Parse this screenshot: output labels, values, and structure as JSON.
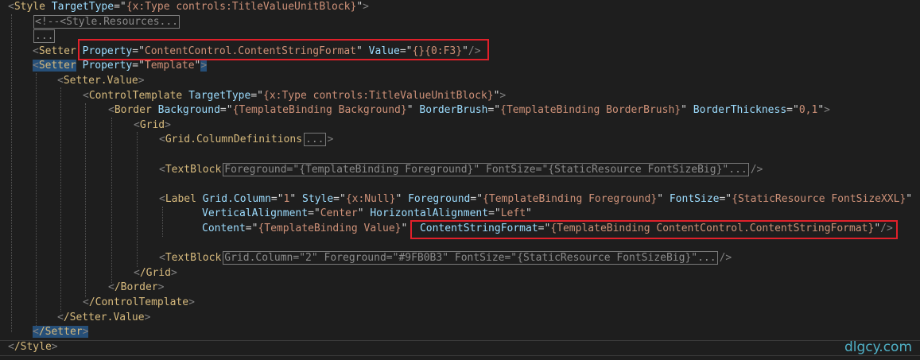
{
  "lines": {
    "l1": {
      "tag": "Style",
      "attr": "TargetType",
      "value": "{x:Type controls:TitleValueUnitBlock}"
    },
    "l2": {
      "collapsed": "<!--<Style.Resources..."
    },
    "l3": {
      "collapsed": "..."
    },
    "l4": {
      "tag": "Setter",
      "attr1": "Property",
      "value1": "ContentControl.ContentStringFormat",
      "attr2": "Value",
      "value2": "{}{0:F3}"
    },
    "l5": {
      "tag": "Setter",
      "attr": "Property",
      "value": "Template"
    },
    "l6": {
      "tag": "Setter.Value"
    },
    "l7": {
      "tag": "ControlTemplate",
      "attr": "TargetType",
      "value": "{x:Type controls:TitleValueUnitBlock}"
    },
    "l8": {
      "tag": "Border",
      "attr1": "Background",
      "value1": "{TemplateBinding Background}",
      "attr2": "BorderBrush",
      "value2": "{TemplateBinding BorderBrush}",
      "attr3": "BorderThickness",
      "value3": "0,1"
    },
    "l9": {
      "tag": "Grid"
    },
    "l10": {
      "tag": "Grid.ColumnDefinitions",
      "collapsed": "..."
    },
    "l12": {
      "tag": "TextBlock",
      "collapsed": "Foreground=\"{TemplateBinding Foreground}\" FontSize=\"{StaticResource FontSizeBig}\"..."
    },
    "l14": {
      "tag": "Label",
      "attr1": "Grid.Column",
      "value1": "1",
      "attr2": "Style",
      "value2": "{x:Null}",
      "attr3": "Foreground",
      "value3": "{TemplateBinding Foreground}",
      "attr4": "FontSize",
      "value4": "{StaticResource FontSizeXXL}"
    },
    "l15": {
      "attr1": "VerticalAlignment",
      "value1": "Center",
      "attr2": "HorizontalAlignment",
      "value2": "Left"
    },
    "l16": {
      "attr1": "Content",
      "value1": "{TemplateBinding Value}",
      "attr2": "ContentStringFormat",
      "value2": "{TemplateBinding ContentControl.ContentStringFormat}"
    },
    "l18": {
      "tag": "TextBlock",
      "collapsed": "Grid.Column=\"2\" Foreground=\"#9FB0B3\" FontSize=\"{StaticResource FontSizeBig}\"..."
    },
    "l19": {
      "tag": "/Grid"
    },
    "l20": {
      "tag": "/Border"
    },
    "l21": {
      "tag": "/ControlTemplate"
    },
    "l22": {
      "tag": "/Setter.Value"
    },
    "l23": {
      "tag": "/Setter"
    },
    "l24": {
      "tag": "/Style"
    }
  },
  "watermark": "dlgcy.com",
  "colors": {
    "highlight_box": "#e0202a",
    "watermark": "#4fb0c6",
    "background": "#1e1e1e"
  }
}
